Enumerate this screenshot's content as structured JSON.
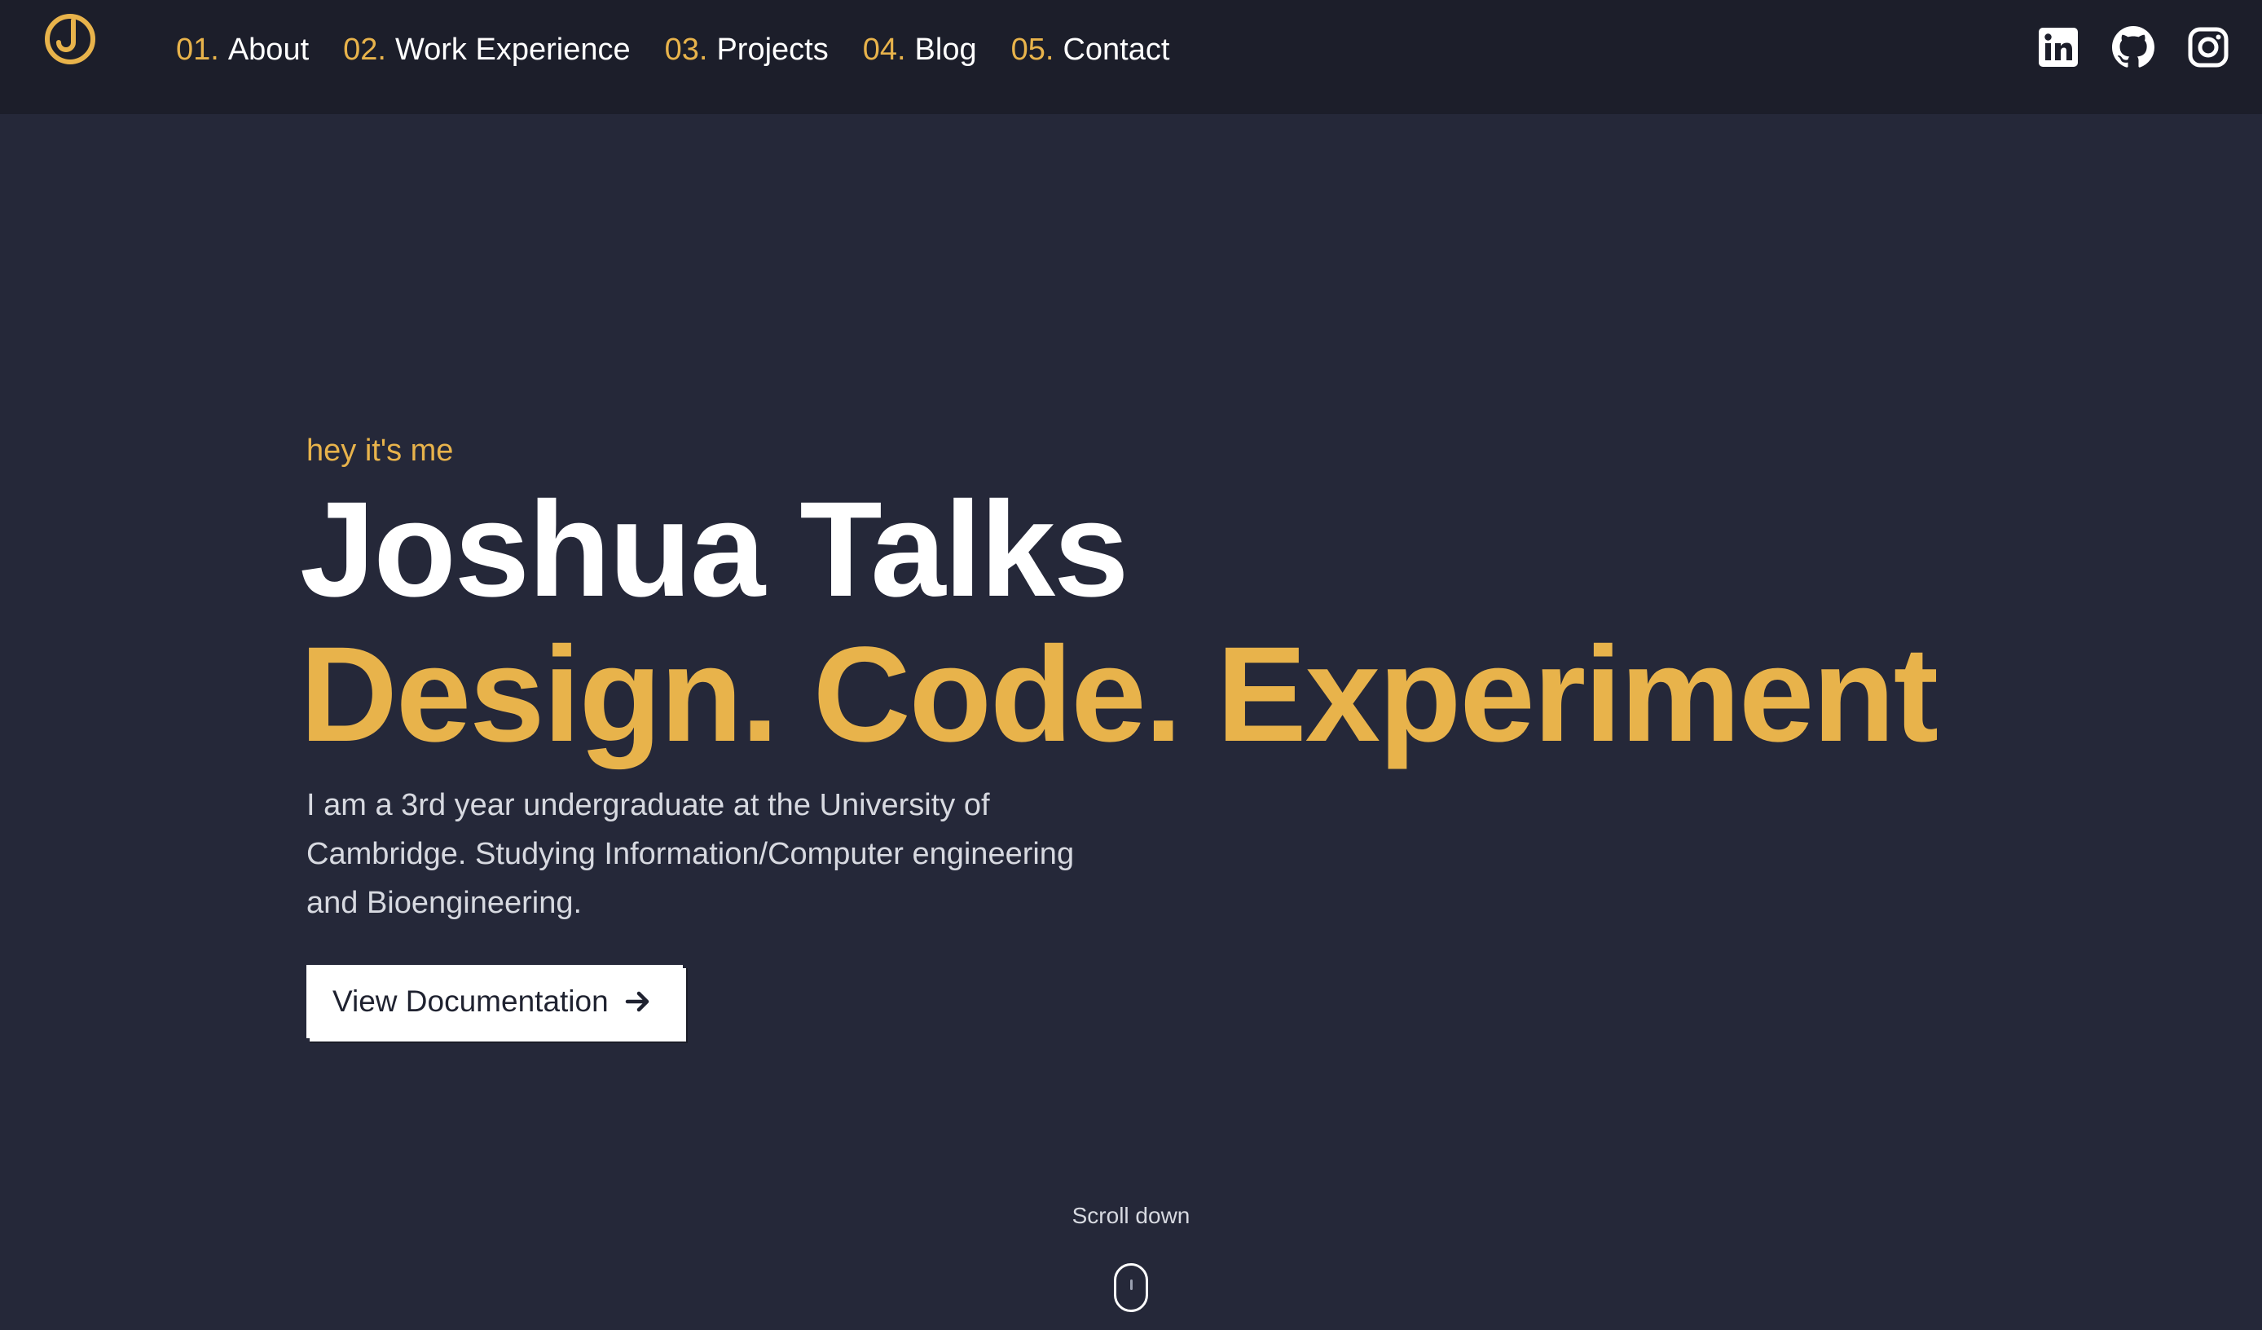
{
  "nav": {
    "links": [
      {
        "num": "01.",
        "label": "About"
      },
      {
        "num": "02.",
        "label": "Work Experience"
      },
      {
        "num": "03.",
        "label": "Projects"
      },
      {
        "num": "04.",
        "label": "Blog"
      },
      {
        "num": "05.",
        "label": "Contact"
      }
    ],
    "social": [
      "linkedin-icon",
      "github-icon",
      "instagram-icon"
    ]
  },
  "hero": {
    "kicker": "hey it's me",
    "name": "Joshua Talks",
    "tagline": "Design. Code. Experiment",
    "intro": "I am a 3rd year undergraduate at the University of Cambridge. Studying Information/Computer engineering and Bioengineering.",
    "button_label": "View Documentation"
  },
  "scroll": {
    "label": "Scroll down"
  },
  "colors": {
    "background": "#252839",
    "navbar": "#1c1e2a",
    "accent": "#e8b34b",
    "text": "#ffffff",
    "muted_text": "#d7d9e0"
  }
}
